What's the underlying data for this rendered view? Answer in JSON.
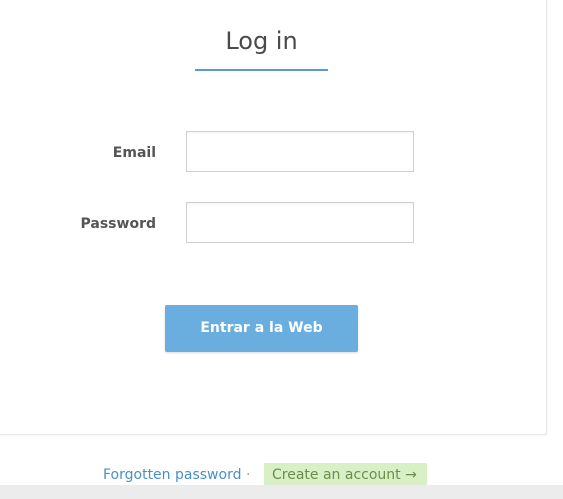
{
  "login": {
    "title": "Log in",
    "email_label": "Email",
    "email_value": "",
    "password_label": "Password",
    "password_value": "",
    "submit_label": "Entrar a la Web"
  },
  "footer": {
    "forgot_password": "Forgotten password",
    "separator": "·",
    "create_account": "Create an account →"
  },
  "colors": {
    "accent": "#6aaee0",
    "underline": "#5b9bd5",
    "link": "#4a8fc7",
    "create_bg": "#d9efc5",
    "create_text": "#6b8e4e"
  }
}
